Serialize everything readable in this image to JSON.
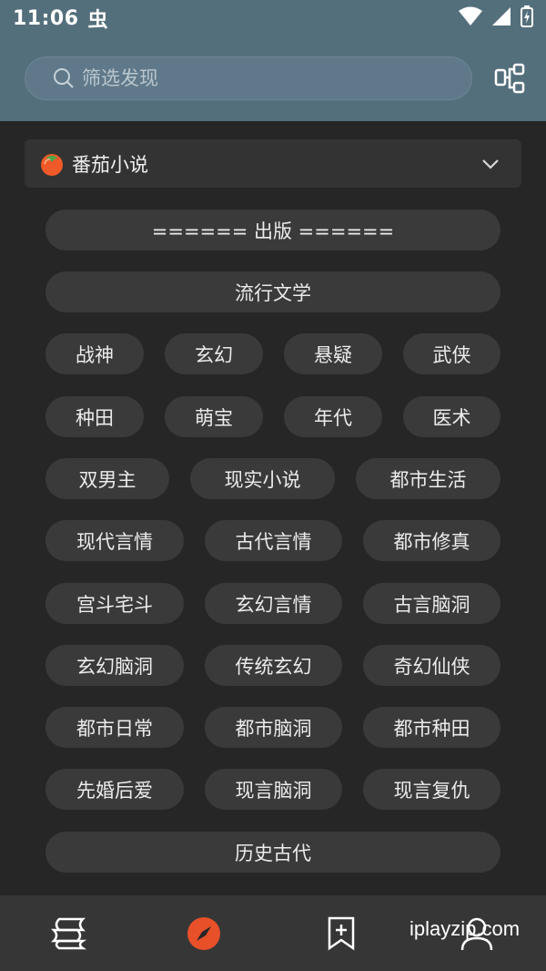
{
  "status_bar": {
    "time": "11:06",
    "app_icon_glyph": "虫"
  },
  "search": {
    "placeholder": "筛选发现"
  },
  "source": {
    "name": "番茄小说"
  },
  "tags": [
    "====== 出版 ======",
    "流行文学",
    "战神",
    "玄幻",
    "悬疑",
    "武侠",
    "种田",
    "萌宝",
    "年代",
    "医术",
    "双男主",
    "现实小说",
    "都市生活",
    "现代言情",
    "古代言情",
    "都市修真",
    "宫斗宅斗",
    "玄幻言情",
    "古言脑洞",
    "玄幻脑洞",
    "传统玄幻",
    "奇幻仙侠",
    "都市日常",
    "都市脑洞",
    "都市种田",
    "先婚后爱",
    "现言脑洞",
    "现言复仇",
    "历史古代"
  ],
  "bottom_nav": {
    "watermark": "iplayzip.com",
    "icons": [
      "bookshelf-icon",
      "explore-compass-icon",
      "bookmark-add-icon",
      "profile-icon"
    ]
  },
  "colors": {
    "header": "#546f7c",
    "background": "#262626",
    "tag": "#3a3a3a",
    "accent": "#e8502a"
  }
}
